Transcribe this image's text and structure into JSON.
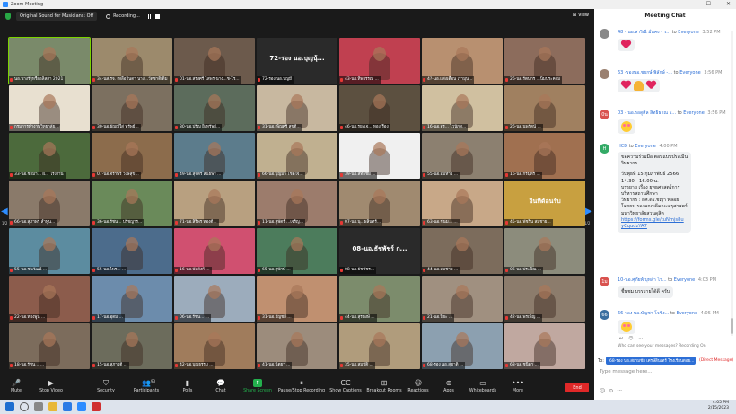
{
  "window": {
    "title": "Zoom Meeting",
    "controls": [
      "—",
      "☐",
      "✕"
    ]
  },
  "topbar": {
    "sound_label": "Original Sound for Musicians: Off",
    "recording_label": "Recording...",
    "view_label": "View"
  },
  "grid": {
    "page_left": "1/2",
    "page_right": "1/2",
    "tiles": [
      {
        "name": "นอ.นางรัฐหรืออลิสสา 2021",
        "bg": "#7a8a6a",
        "active": true
      },
      {
        "name": "34-นส.รจ. เหลือจินดา นาง...วัดชาติเดิม",
        "bg": "#9c8a6c"
      },
      {
        "name": "01-นอ.สรงศรี ไสพร-นาง...ช-โร...",
        "bg": "#6c5a4c"
      },
      {
        "name": "72-รอง นอ.บุญมี",
        "bg": "#2a2a2a",
        "big": "72-รอง นอ.บุญนุ้..."
      },
      {
        "name": "43-นอ.ทิพวรรณ ...",
        "bg": "#c04050"
      },
      {
        "name": "4?-นอ.แสงเดือน เรามุน...",
        "bg": "#b89070"
      },
      {
        "name": "26-นอ.รัตนกร ...นิ่มประคาม",
        "bg": "#8c6c5c"
      },
      {
        "name": "กรมการทำงานวิทยาลัย...",
        "bg": "#e8e0d0"
      },
      {
        "name": "30-นอ.ธัญญ์ใส่ ทรัพย์...",
        "bg": "#7c7060"
      },
      {
        "name": "80-นอ.ปรีญ ยิ่งทรัพย์...",
        "bg": "#5c6c5c"
      },
      {
        "name": "31-นอ.เพ็ญศรี สุขดี...",
        "bg": "#c8b8a0"
      },
      {
        "name": "46-นอ.รยะเจ... ทองเรือง",
        "bg": "#5c5040"
      },
      {
        "name": "16-นอ.อร... ไวนักท...",
        "bg": "#d0c0a0"
      },
      {
        "name": "26-นอ.นพรัตน์ ...",
        "bg": "#a08060"
      },
      {
        "name": "33-นอ.ชามา... ผ... โรงงาน",
        "bg": "#4c6a3c"
      },
      {
        "name": "07-นอ.จิราพร วงษ์สุข...",
        "bg": "#8c6c4c"
      },
      {
        "name": "49-นอ.สุจิตร์ สินธิพร ...",
        "bg": "#5c7c8c"
      },
      {
        "name": "66-นอ.บุญมา โชตใจ...",
        "bg": "#c0b090"
      },
      {
        "name": "39-นอ.สิทธิชัย ...",
        "bg": "#f0f0f0"
      },
      {
        "name": "55-นอ.สมหาย ...",
        "bg": "#8c8070"
      },
      {
        "name": "16-นอ.กรมุทร ...",
        "bg": "#a07050"
      },
      {
        "name": "66-นอ.สุภาพร ลำพูน...",
        "bg": "#8a7a6a"
      },
      {
        "name": "36-นอ.รัชน... ปรัชญาร...",
        "bg": "#6a8a5a"
      },
      {
        "name": "71-นอ.สิริพร ทองดี...",
        "bg": "#b8a080"
      },
      {
        "name": "11-นอ.สุพัดร์ ...เจริญ...",
        "bg": "#9c7c6c"
      },
      {
        "name": "07-นอ.นุ...ผลินทร์...",
        "bg": "#a08a70"
      },
      {
        "name": "63-นอ.ชนม... ...",
        "bg": "#c8a888"
      },
      {
        "name": "45-นอ.พัชริน สมชาย...",
        "bg": "#c8a040",
        "big": "อินทิต้อนรับ"
      },
      {
        "name": "55-นอ.ชนวัฒน์ ...",
        "bg": "#5c8ca0"
      },
      {
        "name": "55-นอ.ไพร... ...",
        "bg": "#4c6c8c"
      },
      {
        "name": "16-นอ.บัลลังก์ ...",
        "bg": "#d05070"
      },
      {
        "name": "65-นอ.สุพักษ์ ...",
        "bg": "#4c7c5c"
      },
      {
        "name": "08-นอ.ธัชพัชร...",
        "bg": "#2a2a2a",
        "big": "08-นอ.ธัชพัชร์ ก..."
      },
      {
        "name": "44-นอ.สมชาย ...",
        "bg": "#7c6c5c"
      },
      {
        "name": "06-นอ.ประพิณ ...",
        "bg": "#8c8c7c"
      },
      {
        "name": "22-นอ.ทองพูน ...",
        "bg": "#8c5c4c"
      },
      {
        "name": "17-นอ.อุดม ...",
        "bg": "#6c8cac"
      },
      {
        "name": "06-นอ.รัชน... ...",
        "bg": "#9cacbc"
      },
      {
        "name": "31-นอ.อัญชลี ...",
        "bg": "#c09070"
      },
      {
        "name": "44-นอ.สุรพงษ์ ...",
        "bg": "#7c8c6c"
      },
      {
        "name": "21-นอ.ปิยะ ...",
        "bg": "#a09080"
      },
      {
        "name": "42-นอ.พรเพ็ญ ...",
        "bg": "#8c7c6c"
      },
      {
        "name": "18-นอ.รัชน... ...",
        "bg": "#7c6c5c"
      },
      {
        "name": "15-นอ.สุภาวดี ...",
        "bg": "#6c6c5c"
      },
      {
        "name": "42-นอ.บุญธรรม ...",
        "bg": "#a07c5c"
      },
      {
        "name": "41-นอ.นิตยา ...",
        "bg": "#9c8c7c"
      },
      {
        "name": "35-นอ.สมบัติ ...",
        "bg": "#b09c7c"
      },
      {
        "name": "68-รอง นอ.สุชาติ ...",
        "bg": "#8ca0b0"
      },
      {
        "name": "63-นอ.ชนิดา ...",
        "bg": "#c0a8a0"
      }
    ]
  },
  "toolbar": {
    "items": [
      {
        "label": "Mute",
        "icon": "microphone-icon",
        "glyph": "🎤"
      },
      {
        "label": "Stop Video",
        "icon": "video-camera-icon",
        "glyph": "▶"
      },
      {
        "label": "Security",
        "icon": "shield-icon",
        "glyph": "⛉"
      },
      {
        "label": "Participants",
        "icon": "people-icon",
        "glyph": "👥",
        "badge": "93"
      },
      {
        "label": "Polls",
        "icon": "poll-chart-icon",
        "glyph": "▮"
      },
      {
        "label": "Chat",
        "icon": "chat-bubble-icon",
        "glyph": "💬"
      },
      {
        "label": "Share Screen",
        "icon": "share-screen-icon",
        "glyph": "⬆"
      },
      {
        "label": "Pause/Stop Recording",
        "icon": "recording-icon",
        "glyph": "⏸"
      },
      {
        "label": "Show Captions",
        "icon": "captions-icon",
        "glyph": "CC"
      },
      {
        "label": "Breakout Rooms",
        "icon": "breakout-rooms-icon",
        "glyph": "⊞"
      },
      {
        "label": "Reactions",
        "icon": "reaction-smile-icon",
        "glyph": "☺"
      },
      {
        "label": "Apps",
        "icon": "apps-icon",
        "glyph": "⊕"
      },
      {
        "label": "Whiteboards",
        "icon": "whiteboard-icon",
        "glyph": "▭"
      },
      {
        "label": "More",
        "icon": "more-dots-icon",
        "glyph": "•••"
      }
    ],
    "end_label": "End"
  },
  "chat": {
    "title": "Meeting Chat",
    "messages": [
      {
        "sender": "48 - นอ.สาริณี มั่นคง - ร...",
        "to": "to",
        "recipient": "Everyone",
        "time": "3:52 PM",
        "avatar_color": "#888",
        "avatar": "",
        "emoji": [
          "heart"
        ]
      },
      {
        "sender": "63 -รองนอ.ชยกษ์ พิลักษ์ -...",
        "to": "to",
        "recipient": "Everyone",
        "time": "3:56 PM",
        "avatar_color": "#9a8070",
        "avatar": "",
        "emoji": [
          "heart",
          "pray",
          "heart"
        ]
      },
      {
        "sender": "03 - นอ.รอดูศิล สิทธิธาณ ร...",
        "to": "to",
        "recipient": "Everyone",
        "time": "3:56 PM",
        "avatar_color": "#d9534f",
        "avatar": "0น",
        "emoji": [
          "smile"
        ]
      },
      {
        "sender": "HCD",
        "to": "to",
        "recipient": "Everyone",
        "time": "4:00 PM",
        "avatar_color": "#33aa66",
        "avatar": "H",
        "lines": [
          "ขอความร่วมมือ ตอบแบบประเมิน",
          "วิทยากร",
          "",
          "วันพุธที่ 15 กุมภาพันธ์ 2566",
          "14.30 - 16.00 น.",
          "บรรยาย เรื่อง ยุทธศาสตร์การ",
          "บริหารสถานศึกษา",
          "วิทยากร : ผศ.ดร.ชญา พลอย",
          "โคกผม รองคณบดีคณะครุศาสตร์",
          "มหาวิทยาลัยสวนดุสิต"
        ],
        "link": [
          "https://forms.gle/tuNmjs8u",
          "yCqudzYA7"
        ]
      },
      {
        "sender": "10-นอ.ศุภัยพ์ บุหลำ โร...",
        "to": "to",
        "recipient": "Everyone",
        "time": "4:03 PM",
        "avatar_color": "#d9534f",
        "avatar": "1ม",
        "text": "ชื่นชม บรรยายได้ดี ครับ"
      },
      {
        "sender": "66-รอง นอ.บัญชา โจชิ่ง...",
        "to": "to",
        "recipient": "Everyone",
        "time": "4:05 PM",
        "avatar_color": "#3a6fa0",
        "avatar": "66",
        "emoji": [
          "smile"
        ]
      }
    ],
    "who_can_see": "Who can see your messages? Recording On",
    "to_label": "To:",
    "to_value": "68-รอง นอ.สยามชัย เศรษ์สินเทร์ โรงเรียนตอย...",
    "dm_label": "(Direct Message)",
    "input_placeholder": "Type message here...",
    "footer_icons": [
      "☺",
      "⊙",
      "···"
    ]
  },
  "taskbar": {
    "time": "4:05 PM",
    "date": "2/15/2023"
  }
}
